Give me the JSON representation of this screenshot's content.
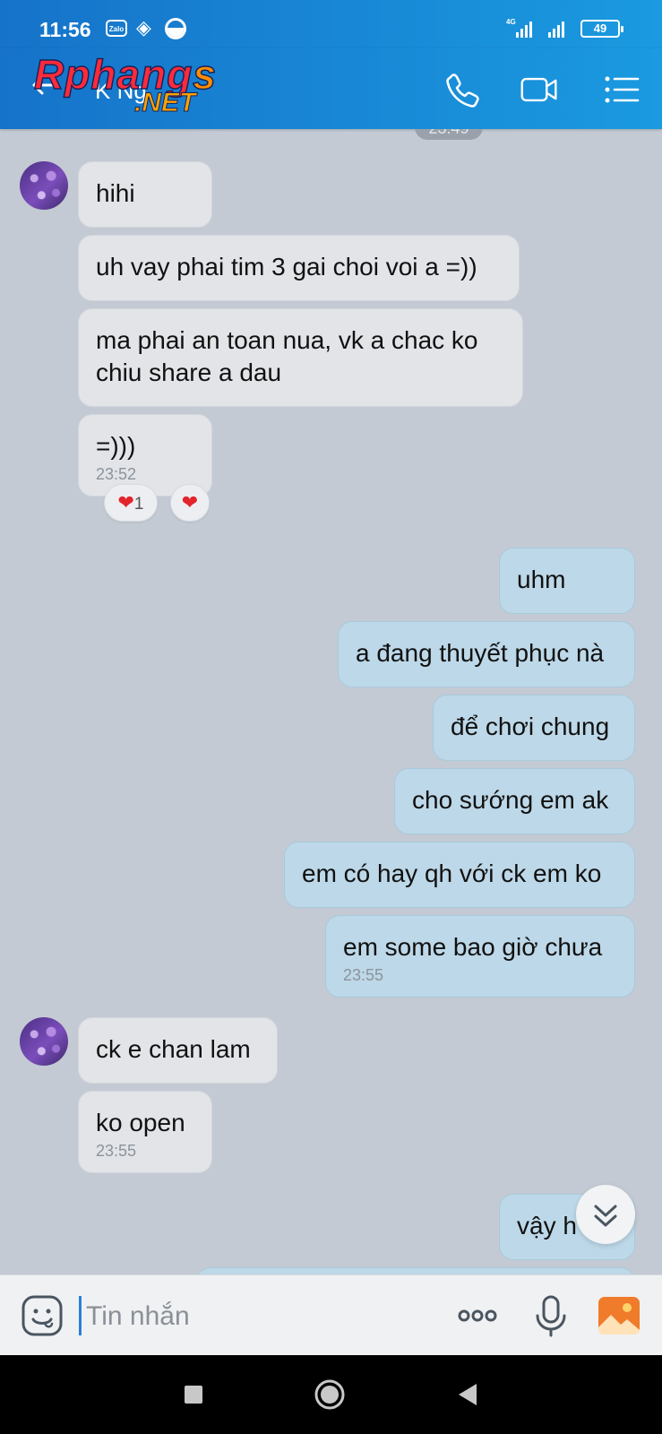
{
  "status_bar": {
    "time": "11:56",
    "zalo_label": "Zalo",
    "network_label": "4G",
    "battery": "49"
  },
  "header": {
    "contact_name": "K Ng",
    "watermark_main": "Rphang",
    "watermark_s": "s",
    "watermark_suffix": ".NET"
  },
  "chat": {
    "date_pill": "23:49",
    "messages": [
      {
        "side": "in",
        "text": "hihi"
      },
      {
        "side": "in",
        "text": "uh vay phai tim 3 gai choi voi a =))"
      },
      {
        "side": "in",
        "text": "ma phai an toan nua, vk a chac ko chiu share a dau"
      },
      {
        "side": "in",
        "text": "=)))",
        "time": "23:52"
      },
      {
        "side": "out",
        "text": "uhm"
      },
      {
        "side": "out",
        "text": "a đang thuyết phục nà"
      },
      {
        "side": "out",
        "text": "để chơi chung"
      },
      {
        "side": "out",
        "text": "cho sướng em ak"
      },
      {
        "side": "out",
        "text": "em có hay qh với ck em ko"
      },
      {
        "side": "out",
        "text": "em some bao giờ chưa",
        "time": "23:55"
      },
      {
        "side": "in",
        "text": "ck e chan lam"
      },
      {
        "side": "in",
        "text": "ko open",
        "time": "23:55"
      },
      {
        "side": "out",
        "text": "vậy h"
      }
    ],
    "reaction_count": "1",
    "reaction_icon": "heart-icon"
  },
  "composer": {
    "placeholder": "Tin nhắn"
  },
  "colors": {
    "header": "#1a8ad8",
    "chat_bg": "#c3cad3",
    "incoming_bubble": "#e2e4e8",
    "outgoing_bubble": "#bdd8e8",
    "heart": "#e3242b"
  }
}
